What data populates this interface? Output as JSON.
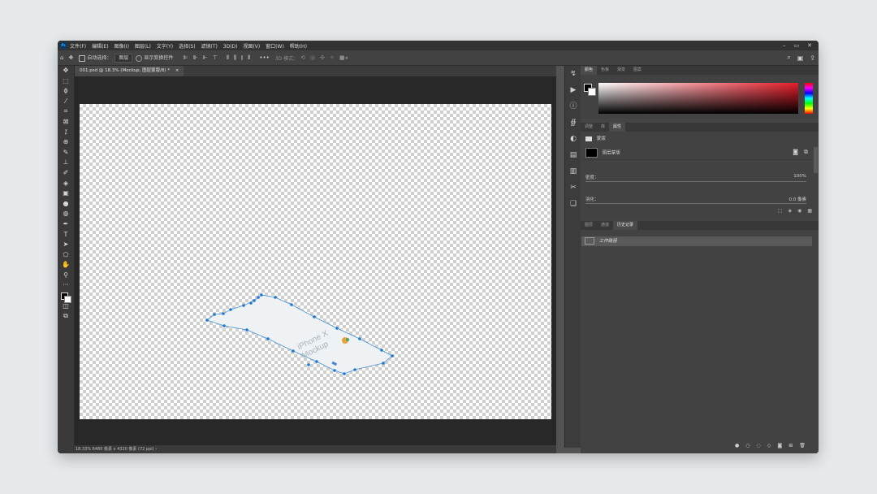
{
  "menubar": {
    "app_badge": "Ps",
    "items": [
      "文件(F)",
      "编辑(E)",
      "图像(I)",
      "图层(L)",
      "文字(Y)",
      "选择(S)",
      "滤镜(T)",
      "3D(D)",
      "视图(V)",
      "窗口(W)",
      "帮助(H)"
    ],
    "window_controls": [
      "–",
      "▭",
      "✕"
    ]
  },
  "options": {
    "auto_select_label": "自动选择：",
    "auto_select_target": "图层",
    "show_transform_label": "显示变换控件",
    "mode_3d_label": "3D 模式："
  },
  "document": {
    "tab_title": "001.psd @ 18.3% (Mockup, 图层蒙版/8) *",
    "close": "×",
    "status": "18.33%   6480 像素 x 4320 像素 (72 ppi)   ›"
  },
  "mockup": {
    "title_line1": "iPhone X",
    "title_line2": "Mockup"
  },
  "panels": {
    "color_tabs": [
      "颜色",
      "色板",
      "渐变",
      "图案"
    ],
    "props_tabs": [
      "调整",
      "库",
      "属性"
    ],
    "props_mask_label": "蒙版",
    "props_layer_mask": "图层蒙版",
    "density_label": "密度：",
    "density_value": "100%",
    "feather_label": "羽化：",
    "feather_value": "0.0 像素",
    "history_tabs": [
      "图层",
      "通道",
      "历史记录"
    ],
    "history_items": [
      "工作路径"
    ]
  }
}
